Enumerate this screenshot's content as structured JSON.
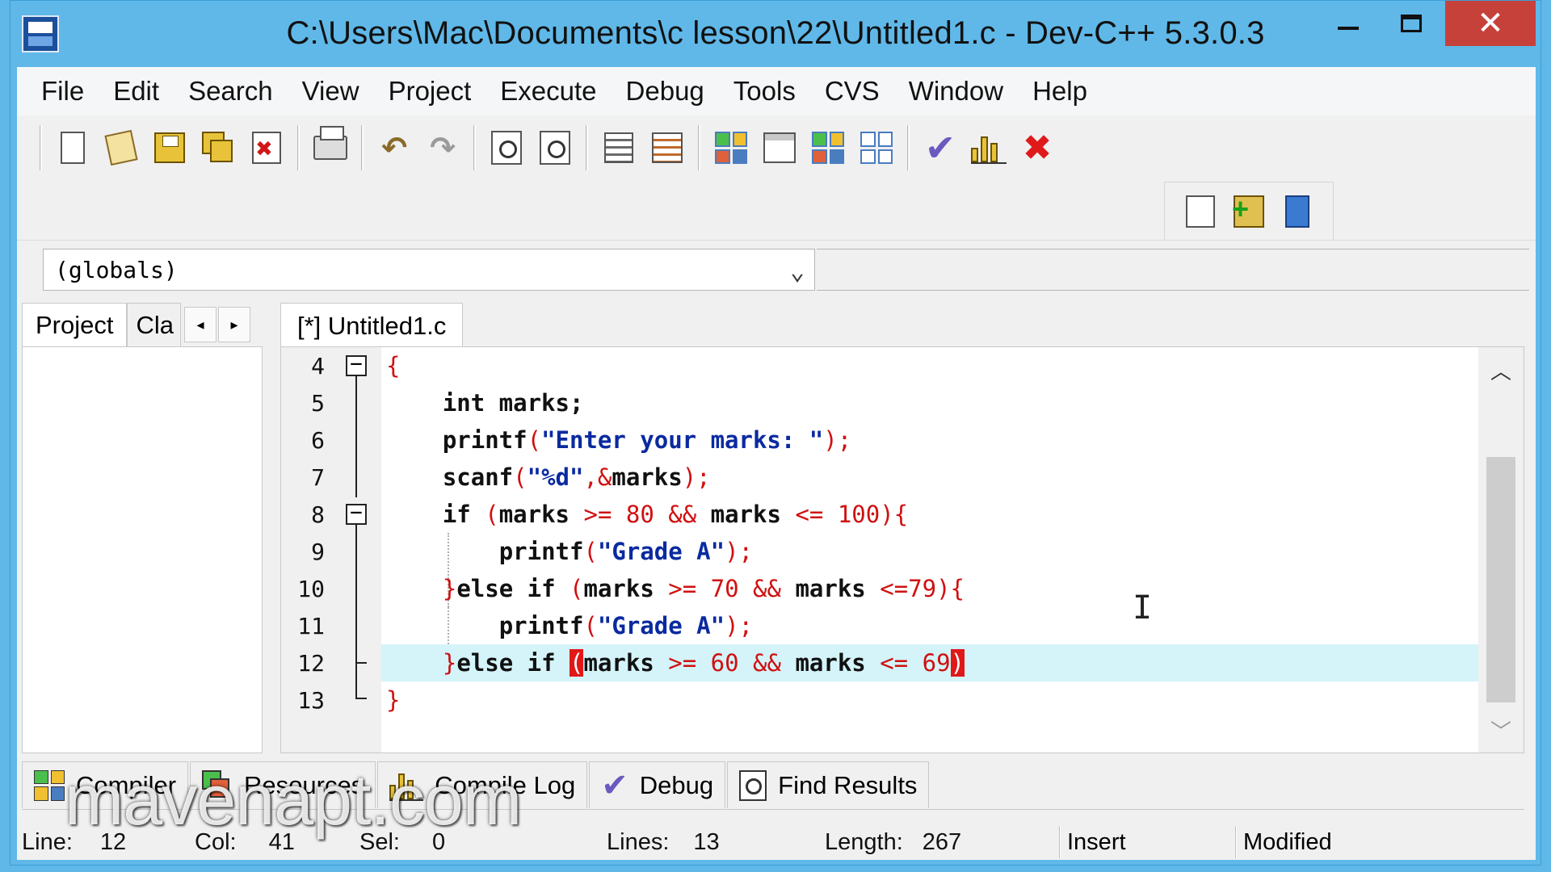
{
  "window": {
    "title": "C:\\Users\\Mac\\Documents\\c lesson\\22\\Untitled1.c - Dev-C++ 5.3.0.3"
  },
  "menu": [
    "File",
    "Edit",
    "Search",
    "View",
    "Project",
    "Execute",
    "Debug",
    "Tools",
    "CVS",
    "Window",
    "Help"
  ],
  "toolbar": {
    "icons": [
      "new-file-icon",
      "open-file-icon",
      "save-icon",
      "save-all-icon",
      "close-file-icon",
      "print-icon",
      "undo-icon",
      "redo-icon",
      "find-icon",
      "find-replace-icon",
      "indent-icon",
      "goto-line-icon",
      "compile-icon",
      "window-icon",
      "rebuild-icon",
      "run-icon",
      "check-icon",
      "chart-icon",
      "stop-icon"
    ],
    "project_icons": [
      "project-options-icon",
      "add-to-project-icon",
      "book-icon"
    ]
  },
  "scope": {
    "value": "(globals)"
  },
  "left_panel": {
    "tabs": [
      "Project",
      "Cla"
    ]
  },
  "editor": {
    "tab_label": "[*] Untitled1.c",
    "current_line": 12,
    "lines": [
      {
        "n": "4",
        "text": "{"
      },
      {
        "n": "5",
        "text": "    int marks;"
      },
      {
        "n": "6",
        "text": "    printf(\"Enter your marks: \");"
      },
      {
        "n": "7",
        "text": "    scanf(\"%d\",&marks);"
      },
      {
        "n": "8",
        "text": "    if (marks >= 80 && marks <= 100){"
      },
      {
        "n": "9",
        "text": "        printf(\"Grade A\");"
      },
      {
        "n": "10",
        "text": "    }else if (marks >= 70 && marks <=79){"
      },
      {
        "n": "11",
        "text": "        printf(\"Grade A\");"
      },
      {
        "n": "12",
        "text": "    }else if (marks >= 60 && marks <= 69)"
      },
      {
        "n": "13",
        "text": "}"
      }
    ]
  },
  "bottom_tabs": [
    {
      "label": "Compiler",
      "icon": "compiler-icon"
    },
    {
      "label": "Resources",
      "icon": "resources-icon"
    },
    {
      "label": "Compile Log",
      "icon": "compile-log-icon"
    },
    {
      "label": "Debug",
      "icon": "debug-check-icon"
    },
    {
      "label": "Find Results",
      "icon": "find-results-icon"
    }
  ],
  "status": {
    "line_label": "Line:",
    "line_value": "12",
    "col_label": "Col:",
    "col_value": "41",
    "sel_label": "Sel:",
    "sel_value": "0",
    "lines_label": "Lines:",
    "lines_value": "13",
    "length_label": "Length:",
    "length_value": "267",
    "mode": "Insert",
    "state": "Modified"
  },
  "watermark": "mavenapt.com",
  "colors": {
    "titlebar": "#5fb8e8",
    "close_button": "#c7413b",
    "current_line": "#d4f4fa",
    "brace_match": "#e01818",
    "string": "#0a2aa0",
    "symbol": "#d01010"
  }
}
